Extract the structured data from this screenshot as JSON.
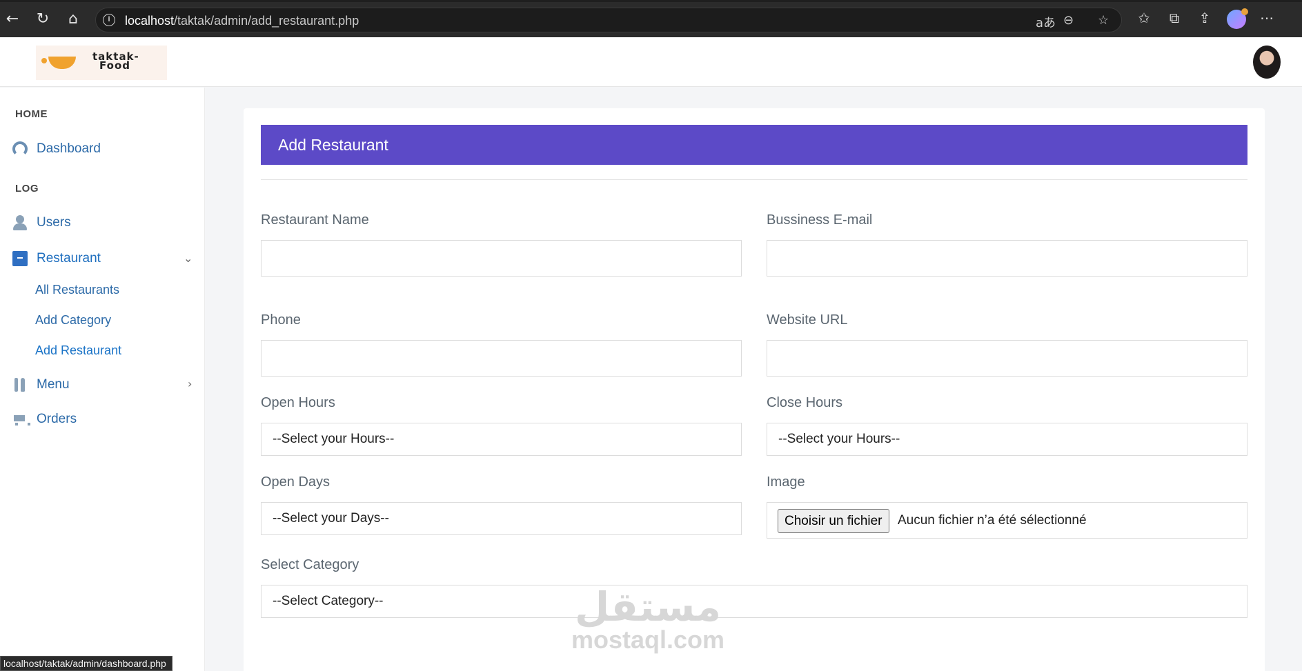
{
  "browser": {
    "url_host": "localhost",
    "url_path": "/taktak/admin/add_restaurant.php",
    "status_url": "localhost/taktak/admin/dashboard.php"
  },
  "header": {
    "logo_text_line1": "taktak-",
    "logo_text_line2": "Food"
  },
  "sidebar": {
    "section_home": "HOME",
    "section_log": "LOG",
    "dashboard": "Dashboard",
    "users": "Users",
    "restaurant": "Restaurant",
    "restaurant_sub": [
      "All Restaurants",
      "Add Category",
      "Add Restaurant"
    ],
    "menu": "Menu",
    "orders": "Orders"
  },
  "form": {
    "title": "Add Restaurant",
    "restaurant_name_label": "Restaurant Name",
    "business_email_label": "Bussiness E-mail",
    "phone_label": "Phone",
    "website_label": "Website URL",
    "open_hours_label": "Open Hours",
    "open_hours_value": "--Select your Hours--",
    "close_hours_label": "Close Hours",
    "close_hours_value": "--Select your Hours--",
    "open_days_label": "Open Days",
    "open_days_value": "--Select your Days--",
    "image_label": "Image",
    "file_button": "Choisir un fichier",
    "file_status": "Aucun fichier n’a été sélectionné",
    "category_label": "Select Category",
    "category_value": "--Select Category--"
  },
  "watermark": {
    "arabic": "مستقل",
    "latin": "mostaql.com"
  },
  "colors": {
    "header_accent": "#5c4ac7",
    "link_blue": "#1f6fbf"
  }
}
